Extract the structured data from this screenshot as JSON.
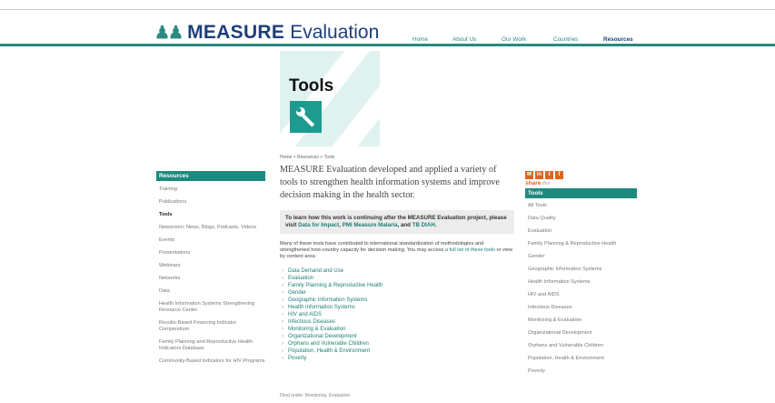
{
  "header": {
    "logo_primary": "MEASURE",
    "logo_secondary": "Evaluation",
    "nav": [
      "Home",
      "About Us",
      "Our Work",
      "Countries",
      "Resources"
    ]
  },
  "hero": {
    "title": "Tools"
  },
  "breadcrumb": "Home > Resources > Tools",
  "left_nav": {
    "heading": "Resources",
    "items": [
      "Training",
      "Publications",
      "Tools",
      "Newsroom: News, Blogs, Podcasts, Videos",
      "Events",
      "Presentations",
      "Webinars",
      "Networks",
      "Data",
      "Health Information Systems Strengthening Resource Center",
      "Results-Based Financing Indicator Compendium",
      "Family Planning and Reproductive Health Indicators Database",
      "Community-Based Indicators for HIV Programs"
    ],
    "active_item": "Tools"
  },
  "main": {
    "lead": "MEASURE Evaluation developed and applied a variety of tools to strengthen health information systems and improve decision making in the health sector.",
    "callout_text": "To learn how this work is continuing after the MEASURE Evaluation project, please visit",
    "callout_link1": "Data for Impact",
    "callout_sep1": ",",
    "callout_link2": "PMI Measure Malaria",
    "callout_sep2": ", and",
    "callout_link3": "TB DIAH",
    "callout_end": ".",
    "para_text": "Many of these tools have contributed to international standardization of methodologies and strengthened host-country capacity for decision making. You may access",
    "para_link": "a full list of these tools",
    "para_end": "or view by content area:",
    "content_areas": [
      "Data Demand and Use",
      "Evaluation",
      "Family Planning & Reproductive Health",
      "Gender",
      "Geographic Information Systems",
      "Health Information Systems",
      "HIV and AIDS",
      "Infectious Diseases",
      "Monitoring & Evaluation",
      "Organizational Development",
      "Orphans and Vulnerable Children",
      "Population, Health & Environment",
      "Poverty"
    ],
    "filed_under": "Filed under: Monitoring, Evaluation"
  },
  "right_nav": {
    "share_label": "share",
    "share_sub": "this",
    "heading": "Tools",
    "items": [
      "All Tools",
      "Data Quality",
      "Evaluation",
      "Family Planning & Reproductive Health",
      "Gender",
      "Geographic Information Systems",
      "Health Information Systems",
      "HIV and AIDS",
      "Infectious Diseases",
      "Monitoring & Evaluation",
      "Organizational Development",
      "Orphans and Vulnerable Children",
      "Population, Health & Environment",
      "Poverty"
    ]
  }
}
